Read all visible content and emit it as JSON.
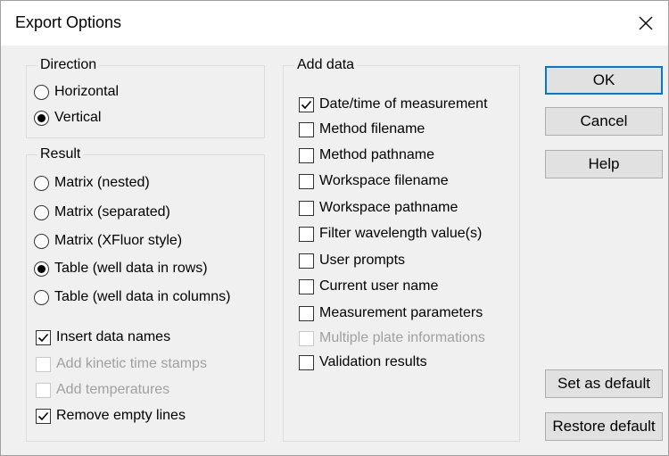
{
  "window": {
    "title": "Export Options"
  },
  "direction": {
    "label": "Direction",
    "options": [
      {
        "label": "Horizontal",
        "selected": false
      },
      {
        "label": "Vertical",
        "selected": true
      }
    ]
  },
  "result": {
    "label": "Result",
    "options": [
      {
        "label": "Matrix (nested)",
        "selected": false
      },
      {
        "label": "Matrix (separated)",
        "selected": false
      },
      {
        "label": "Matrix (XFluor style)",
        "selected": false
      },
      {
        "label": "Table (well data in rows)",
        "selected": true
      },
      {
        "label": "Table (well data in columns)",
        "selected": false
      }
    ],
    "checks": [
      {
        "label": "Insert data names",
        "checked": true,
        "enabled": true
      },
      {
        "label": "Add kinetic time stamps",
        "checked": false,
        "enabled": false
      },
      {
        "label": "Add temperatures",
        "checked": false,
        "enabled": false
      },
      {
        "label": "Remove empty lines",
        "checked": true,
        "enabled": true
      }
    ]
  },
  "add_data": {
    "label": "Add data",
    "items": [
      {
        "label": "Date/time of measurement",
        "checked": true,
        "enabled": true
      },
      {
        "label": "Method filename",
        "checked": false,
        "enabled": true
      },
      {
        "label": "Method pathname",
        "checked": false,
        "enabled": true
      },
      {
        "label": "Workspace filename",
        "checked": false,
        "enabled": true
      },
      {
        "label": "Workspace pathname",
        "checked": false,
        "enabled": true
      },
      {
        "label": "Filter wavelength value(s)",
        "checked": false,
        "enabled": true
      },
      {
        "label": "User prompts",
        "checked": false,
        "enabled": true
      },
      {
        "label": "Current user name",
        "checked": false,
        "enabled": true
      },
      {
        "label": "Measurement parameters",
        "checked": false,
        "enabled": true
      },
      {
        "label": "Multiple plate informations",
        "checked": false,
        "enabled": false
      },
      {
        "label": "Validation results",
        "checked": false,
        "enabled": true
      }
    ]
  },
  "buttons": {
    "ok": "OK",
    "cancel": "Cancel",
    "help": "Help",
    "set_default": "Set as default",
    "restore_default": "Restore default"
  }
}
